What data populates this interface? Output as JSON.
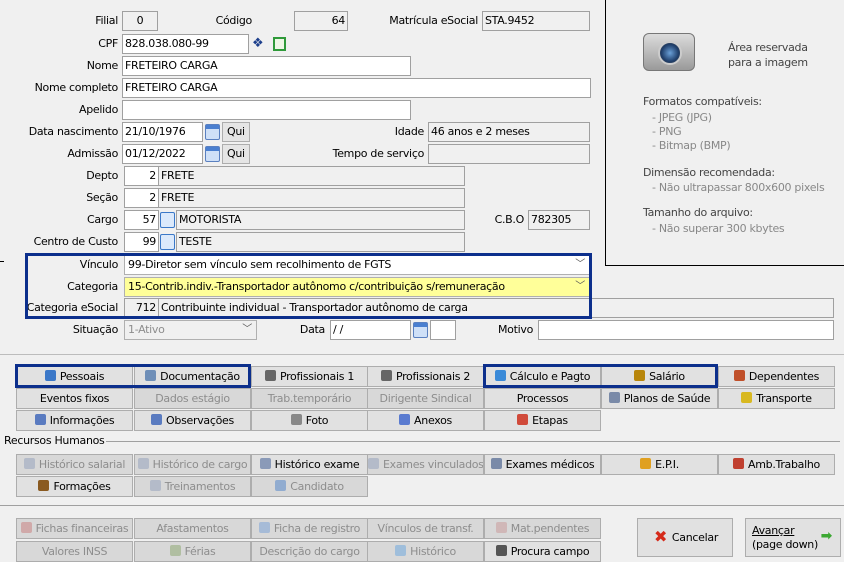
{
  "form": {
    "filial": {
      "label": "Filial",
      "value": "0"
    },
    "codigo": {
      "label": "Código",
      "value": "64"
    },
    "matricula": {
      "label": "Matrícula eSocial",
      "value": "STA.9452"
    },
    "cpf": {
      "label": "CPF",
      "value": "828.038.080-99"
    },
    "nome": {
      "label": "Nome",
      "value": "FRETEIRO CARGA"
    },
    "nome_completo": {
      "label": "Nome completo",
      "value": "FRETEIRO CARGA"
    },
    "apelido": {
      "label": "Apelido",
      "value": ""
    },
    "data_nascimento": {
      "label": "Data nascimento",
      "value": "21/10/1976",
      "day": "Qui"
    },
    "idade": {
      "label": "Idade",
      "value": "46 anos e 2 meses"
    },
    "admissao": {
      "label": "Admissão",
      "value": "01/12/2022",
      "day": "Qui"
    },
    "tempo_servico": {
      "label": "Tempo de serviço",
      "value": ""
    },
    "depto": {
      "label": "Depto",
      "code": "2",
      "name": "FRETE"
    },
    "secao": {
      "label": "Seção",
      "code": "2",
      "name": "FRETE"
    },
    "cargo": {
      "label": "Cargo",
      "code": "57",
      "name": "MOTORISTA"
    },
    "cbo": {
      "label": "C.B.O",
      "value": "782305"
    },
    "centro_custo": {
      "label": "Centro de Custo",
      "code": "99",
      "name": "TESTE"
    },
    "vinculo": {
      "label": "Vínculo",
      "value": "99-Diretor sem vínculo sem recolhimento de FGTS"
    },
    "categoria": {
      "label": "Categoria",
      "value": "15-Contrib.indiv.-Transportador autônomo c/contribuição s/remuneração"
    },
    "categoria_esocial": {
      "label": "Categoria eSocial",
      "code": "712",
      "name": "Contribuinte individual - Transportador autônomo de carga"
    },
    "situacao": {
      "label": "Situação",
      "value": "1-Ativo"
    },
    "data": {
      "label": "Data",
      "value": " / /"
    },
    "motivo": {
      "label": "Motivo",
      "value": ""
    }
  },
  "image_panel": {
    "title": "Área reservada para a imagem",
    "formats_title": "Formatos compatíveis:",
    "formats": [
      "- JPEG (JPG)",
      "- PNG",
      "- Bitmap (BMP)"
    ],
    "dimension_title": "Dimensão recomendada:",
    "dimension": "- Não ultrapassar 800x600 pixels",
    "size_title": "Tamanho do arquivo:",
    "size": "- Não superar 300 kbytes"
  },
  "section_rh": "Recursos Humanos",
  "tabs_rows": [
    [
      {
        "label": "Pessoais",
        "icon": "person-icon",
        "enabled": true
      },
      {
        "label": "Documentação",
        "icon": "document-icon",
        "enabled": true
      },
      {
        "label": "Profissionais 1",
        "icon": "book-icon",
        "enabled": true
      },
      {
        "label": "Profissionais 2",
        "icon": "book-icon",
        "enabled": true
      },
      {
        "label": "Cálculo e Pagto",
        "icon": "calculator-icon",
        "enabled": true
      },
      {
        "label": "Salário",
        "icon": "money-bag-icon",
        "enabled": true
      },
      {
        "label": "Dependentes",
        "icon": "family-icon",
        "enabled": true
      }
    ],
    [
      {
        "label": "Eventos fixos",
        "enabled": true
      },
      {
        "label": "Dados estágio",
        "enabled": false
      },
      {
        "label": "Trab.temporário",
        "enabled": false
      },
      {
        "label": "Dirigente Sindical",
        "enabled": false
      },
      {
        "label": "Processos",
        "enabled": true
      },
      {
        "label": "Planos de Saúde",
        "icon": "ambulance-icon",
        "enabled": true
      },
      {
        "label": "Transporte",
        "icon": "bus-icon",
        "enabled": true
      }
    ],
    [
      {
        "label": "Informações",
        "icon": "page-icon",
        "enabled": true
      },
      {
        "label": "Observações",
        "icon": "page-icon",
        "enabled": true
      },
      {
        "label": "Foto",
        "icon": "camera-icon",
        "enabled": true
      },
      {
        "label": "Anexos",
        "icon": "paperclip-icon",
        "enabled": true
      },
      {
        "label": "Etapas",
        "icon": "checklist-icon",
        "enabled": true
      }
    ]
  ],
  "rh_rows": [
    [
      {
        "label": "Histórico salarial",
        "icon": "stethoscope-icon",
        "enabled": false
      },
      {
        "label": "Histórico de cargo",
        "icon": "stethoscope-icon",
        "enabled": false
      },
      {
        "label": "Histórico exame",
        "icon": "stethoscope-icon",
        "enabled": true
      },
      {
        "label": "Exames vinculados",
        "icon": "stethoscope-icon",
        "enabled": false
      },
      {
        "label": "Exames médicos",
        "icon": "ambulance-icon",
        "enabled": true
      },
      {
        "label": "E.P.I.",
        "icon": "worker-icon",
        "enabled": true
      },
      {
        "label": "Amb.Trabalho",
        "icon": "factory-icon",
        "enabled": true
      }
    ],
    [
      {
        "label": "Formações",
        "icon": "graduation-cap-icon",
        "enabled": true
      },
      {
        "label": "Treinamentos",
        "icon": "stethoscope-icon",
        "enabled": false
      },
      {
        "label": "Candidato",
        "icon": "person-icon",
        "enabled": false
      }
    ]
  ],
  "bottom_rows": [
    [
      {
        "label": "Fichas financeiras",
        "icon": "list-icon",
        "enabled": false
      },
      {
        "label": "Afastamentos",
        "enabled": false
      },
      {
        "label": "Ficha de registro",
        "icon": "id-card-icon",
        "enabled": false
      },
      {
        "label": "Vínculos de transf.",
        "enabled": false
      },
      {
        "label": "Mat.pendentes",
        "icon": "hand-icon",
        "enabled": false
      }
    ],
    [
      {
        "label": "Valores INSS",
        "enabled": false
      },
      {
        "label": "Férias",
        "icon": "picture-icon",
        "enabled": false
      },
      {
        "label": "Descrição do cargo",
        "enabled": false
      },
      {
        "label": "Histórico",
        "icon": "clock-icon",
        "enabled": false
      },
      {
        "label": "Procura campo",
        "icon": "binoculars-icon",
        "enabled": true
      }
    ]
  ],
  "actions": {
    "cancel": "Cancelar",
    "next": "Avançar",
    "next_hint": "(page down)"
  },
  "colors": {
    "highlight": "#0c2f8c",
    "categoria_bg": "#ffff99"
  }
}
